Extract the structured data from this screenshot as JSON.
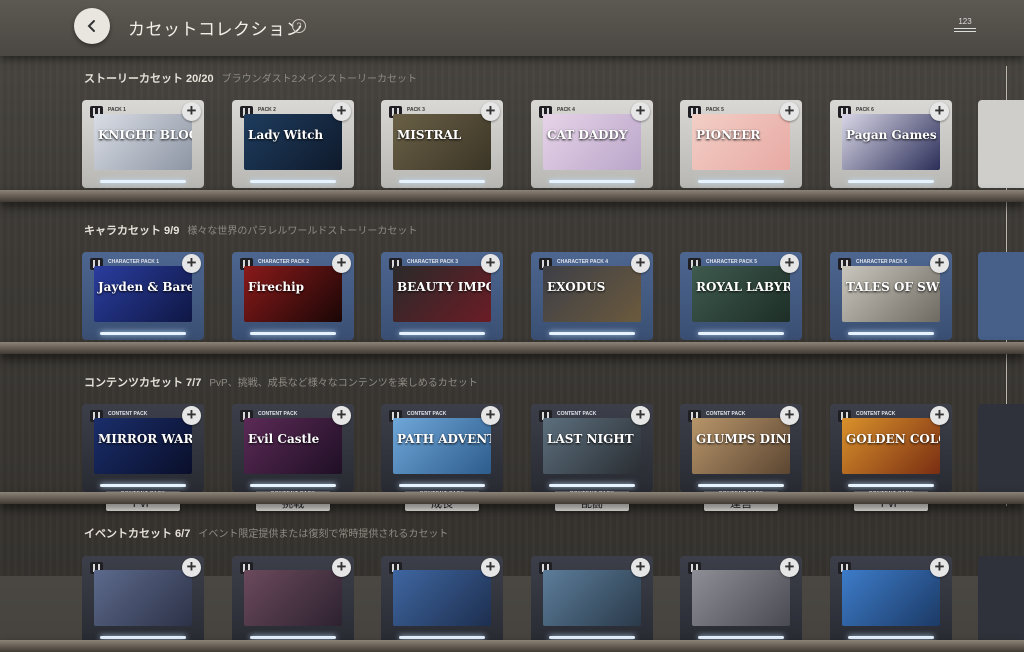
{
  "header": {
    "title": "カセットコレクション",
    "help_icon": "?",
    "sort_label": "123"
  },
  "sections": [
    {
      "name": "ストーリーカセット 20/20",
      "desc": "ブラウンダスト2メインストーリーカセット",
      "items": [
        {
          "pack": "PACK 1",
          "art_text": "KNIGHT BLOOD",
          "c1": "#d9dde5",
          "c2": "#8d95a3"
        },
        {
          "pack": "PACK 2",
          "art_text": "Lady Witch",
          "c1": "#1e3c5e",
          "c2": "#0f1a2b"
        },
        {
          "pack": "PACK 3",
          "art_text": "MISTRAL",
          "c1": "#6a6046",
          "c2": "#3b3526"
        },
        {
          "pack": "PACK 4",
          "art_text": "CAT DADDY",
          "c1": "#e7d4e8",
          "c2": "#b9a5c9"
        },
        {
          "pack": "PACK 5",
          "art_text": "PIONEER",
          "c1": "#f2cfc6",
          "c2": "#e8a9a3"
        },
        {
          "pack": "PACK 6",
          "art_text": "Pagan Games",
          "c1": "#d8d6e6",
          "c2": "#2b2e58"
        }
      ]
    },
    {
      "name": "キャラカセット 9/9",
      "desc": "様々な世界のパラレルワールドストーリーカセット",
      "items": [
        {
          "pack": "CHARACTER PACK 1",
          "art_text": "Jayden & Bare",
          "c1": "#2a3d9e",
          "c2": "#0f1744"
        },
        {
          "pack": "CHARACTER PACK 2",
          "art_text": "Firechip",
          "c1": "#8a1a1a",
          "c2": "#1a0606"
        },
        {
          "pack": "CHARACTER PACK 3",
          "art_text": "BEAUTY IMPOSSIBLE",
          "c1": "#2a2a2a",
          "c2": "#6b1c25"
        },
        {
          "pack": "CHARACTER PACK 4",
          "art_text": "EXODUS",
          "c1": "#3d3f47",
          "c2": "#6b5a3d"
        },
        {
          "pack": "CHARACTER PACK 5",
          "art_text": "ROYAL LABYRINTH",
          "c1": "#3f5a4e",
          "c2": "#1d2e27"
        },
        {
          "pack": "CHARACTER PACK 6",
          "art_text": "TALES OF SWORD",
          "c1": "#c9c6bd",
          "c2": "#6e6a61"
        }
      ]
    },
    {
      "name": "コンテンツカセット 7/7",
      "desc": "PvP、挑戦、成長など様々なコンテンツを楽しめるカセット",
      "items": [
        {
          "pack": "CONTENT PACK",
          "art_text": "MIRROR WARS",
          "c1": "#1a2e6b",
          "c2": "#0a0f2a",
          "tag_kind": "CONTENT PACK",
          "tag": "PvP"
        },
        {
          "pack": "CONTENT PACK",
          "art_text": "Evil Castle",
          "c1": "#5b2a56",
          "c2": "#1f0f25",
          "tag_kind": "CONTENT PACK",
          "tag": "挑戦"
        },
        {
          "pack": "CONTENT PACK",
          "art_text": "PATH ADVENTURE",
          "c1": "#6fa7d9",
          "c2": "#2d5c8c",
          "tag_kind": "CONTENT PACK",
          "tag": "成長"
        },
        {
          "pack": "CONTENT PACK",
          "art_text": "LAST NIGHT",
          "c1": "#5c6f7d",
          "c2": "#2a2e33",
          "tag_kind": "CONTENT PACK",
          "tag": "乱闘"
        },
        {
          "pack": "CONTENT PACK",
          "art_text": "GLUMPS DINER",
          "c1": "#b7956a",
          "c2": "#5c4632",
          "tag_kind": "CONTENT PACK",
          "tag": "運営"
        },
        {
          "pack": "CONTENT PACK",
          "art_text": "GOLDEN COLOSSEUM",
          "c1": "#d9912b",
          "c2": "#7a2e12",
          "tag_kind": "CONTENT PACK",
          "tag": "PvP"
        }
      ]
    },
    {
      "name": "イベントカセット 6/7",
      "desc": "イベント限定提供または復刻で常時提供されるカセット",
      "items": [
        {
          "pack": "",
          "art_text": "",
          "c1": "#5c6a8c",
          "c2": "#2d3247"
        },
        {
          "pack": "",
          "art_text": "",
          "c1": "#6b4a5c",
          "c2": "#2d2230"
        },
        {
          "pack": "",
          "art_text": "",
          "c1": "#3f66a1",
          "c2": "#1d2f4f"
        },
        {
          "pack": "",
          "art_text": "",
          "c1": "#5c7d9a",
          "c2": "#2a3a4a"
        },
        {
          "pack": "",
          "art_text": "",
          "c1": "#8e8e96",
          "c2": "#4a4a52"
        },
        {
          "pack": "",
          "art_text": "",
          "c1": "#3d7cc9",
          "c2": "#1c3a66"
        }
      ]
    }
  ]
}
